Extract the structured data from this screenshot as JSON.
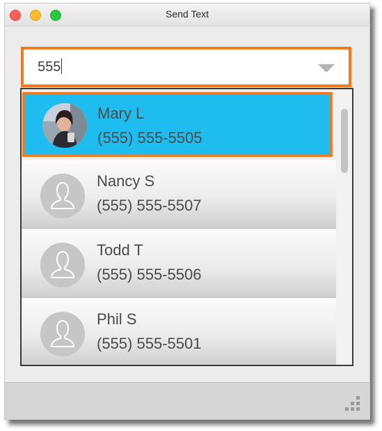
{
  "window": {
    "title": "Send Text"
  },
  "search": {
    "value": "555",
    "dropdown_icon": "triangle-down-icon"
  },
  "contacts": [
    {
      "name": "Mary L",
      "phone": "(555) 555-5505",
      "selected": true,
      "avatar": "photo"
    },
    {
      "name": "Nancy S",
      "phone": "(555) 555-5507",
      "selected": false,
      "avatar": "person-placeholder-icon"
    },
    {
      "name": "Todd T",
      "phone": "(555) 555-5506",
      "selected": false,
      "avatar": "person-placeholder-icon"
    },
    {
      "name": "Phil S",
      "phone": "(555) 555-5501",
      "selected": false,
      "avatar": "person-placeholder-icon"
    }
  ],
  "colors": {
    "highlight": "#f47a20",
    "selected_row": "#1fbdef"
  }
}
